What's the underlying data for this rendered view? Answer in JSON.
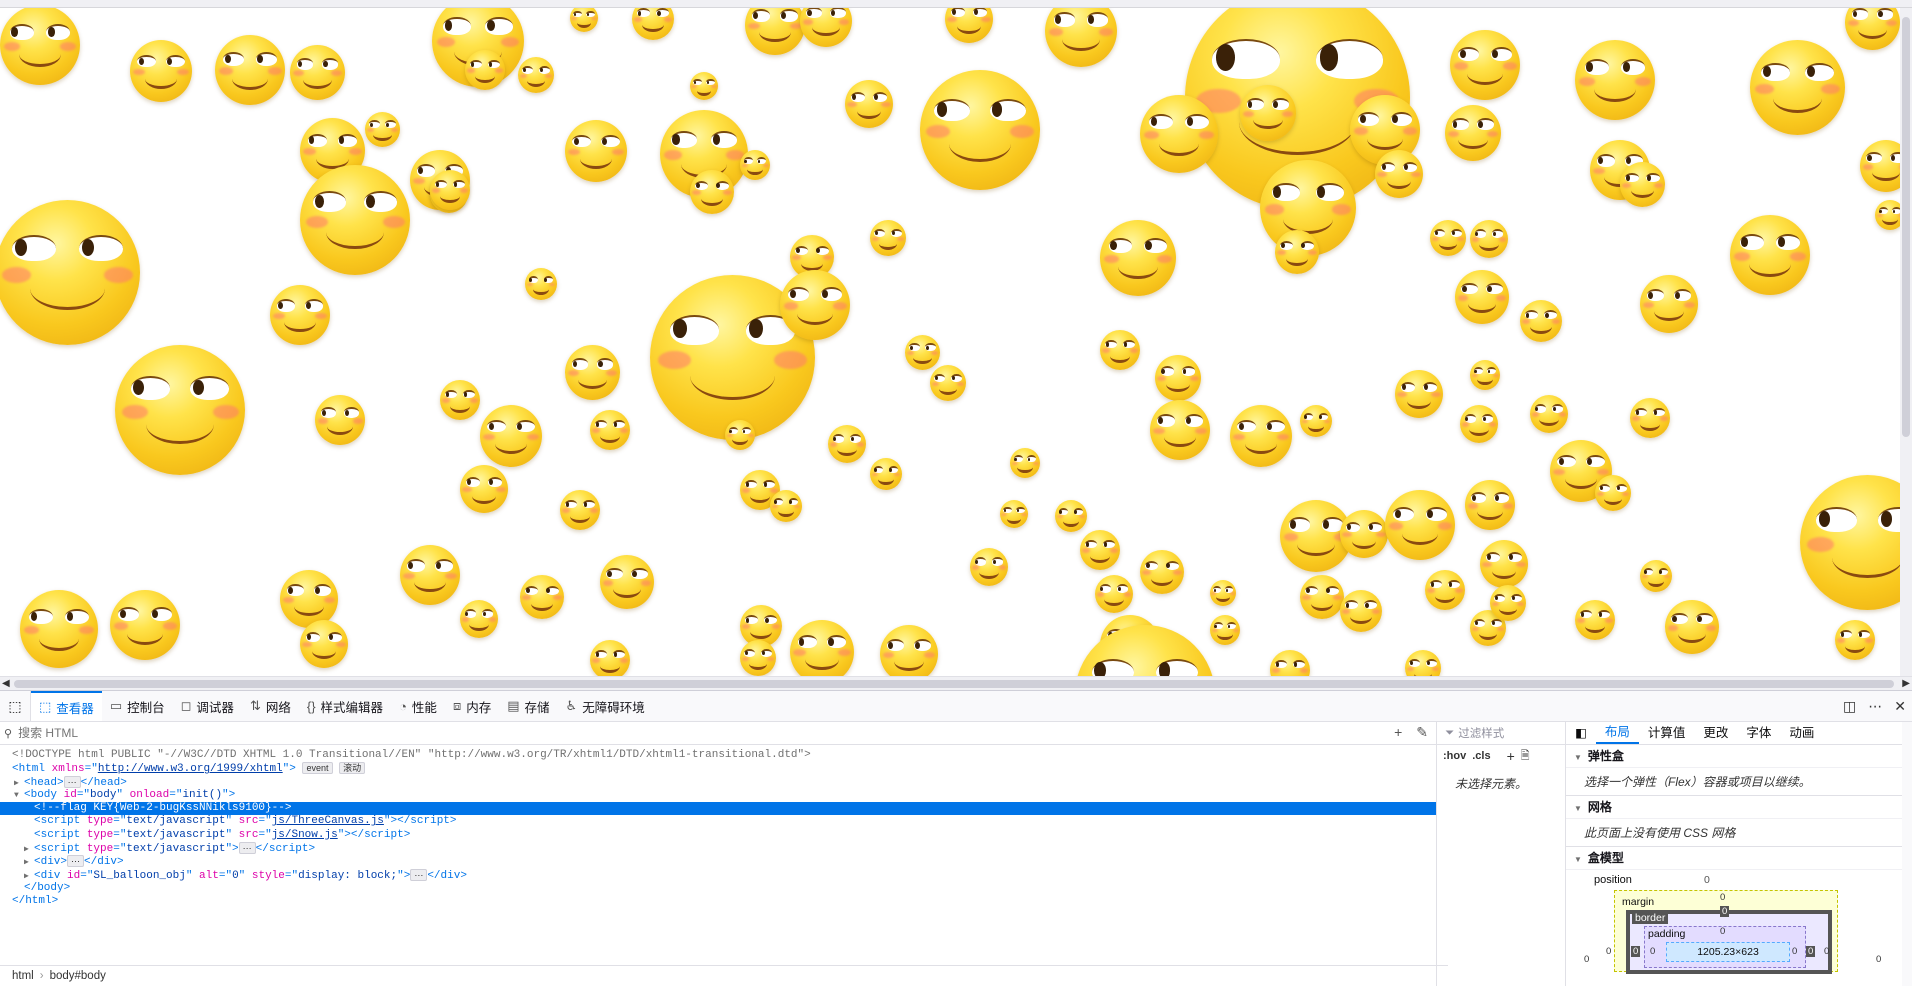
{
  "devtools": {
    "tabs": [
      {
        "label": "查看器",
        "icon": "inspector-icon",
        "active": true
      },
      {
        "label": "控制台",
        "icon": "console-icon"
      },
      {
        "label": "调试器",
        "icon": "debugger-icon"
      },
      {
        "label": "网络",
        "icon": "network-icon"
      },
      {
        "label": "样式编辑器",
        "icon": "style-editor-icon"
      },
      {
        "label": "性能",
        "icon": "performance-icon"
      },
      {
        "label": "内存",
        "icon": "memory-icon"
      },
      {
        "label": "存储",
        "icon": "storage-icon"
      },
      {
        "label": "无障碍环境",
        "icon": "accessibility-icon"
      }
    ],
    "search_placeholder": "搜索 HTML",
    "markup": {
      "doctype": "<!DOCTYPE html PUBLIC \"-//W3C//DTD XHTML 1.0 Transitional//EN\" \"http://www.w3.org/TR/xhtml1/DTD/xhtml1-transitional.dtd\">",
      "html_xmlns": "http://www.w3.org/1999/xhtml",
      "event_badge": "event",
      "scroll_badge": "滚动",
      "body_id": "body",
      "body_onload": "init()",
      "comment": "<!--flag KEY{Web-2-bugKssNNikls9100}-->",
      "script1_src": "js/ThreeCanvas.js",
      "script2_src": "js/Snow.js",
      "script_type": "text/javascript",
      "div_id": "SL_balloon_obj",
      "div_alt": "0",
      "div_style": "display: block;"
    },
    "breadcrumbs": [
      "html",
      "body#body"
    ],
    "rules": {
      "filter_placeholder": "过滤样式",
      "hov": ":hov",
      "cls": ".cls",
      "empty_text": "未选择元素。"
    },
    "layout": {
      "tabs": [
        "布局",
        "计算值",
        "更改",
        "字体",
        "动画"
      ],
      "flex_title": "弹性盒",
      "flex_text": "选择一个弹性（Flex）容器或项目以继续。",
      "grid_title": "网格",
      "grid_text": "此页面上没有使用 CSS 网格",
      "boxmodel_title": "盒模型",
      "position_label": "position",
      "position_value": "0",
      "margin_label": "margin",
      "border_label": "border",
      "padding_label": "padding",
      "content_size": "1205.23×623",
      "zero": "0"
    }
  }
}
